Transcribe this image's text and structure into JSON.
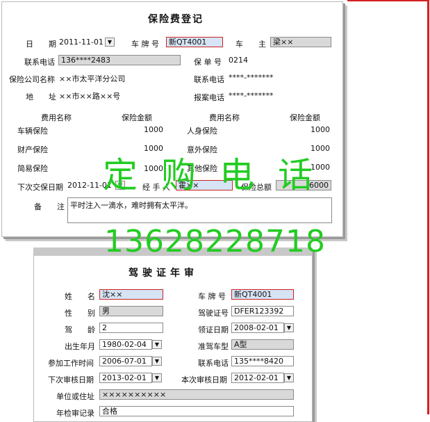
{
  "form1": {
    "title": "保险费登记",
    "date_label": "日　　期",
    "date_value": "2011-11-01",
    "plate_label": "车 牌 号",
    "plate_value": "新QT4001",
    "owner_label": "车　　主",
    "owner_value": "梁××",
    "phone_label": "联系电话",
    "phone_value": "136****2483",
    "policy_label": "保 单 号",
    "policy_value": "0214",
    "company_label": "保险公司名称",
    "company_value": "××市太平洋分公司",
    "company_phone_label": "联系电话",
    "company_phone_value": "****-*******",
    "address_label": "地　　址",
    "address_value": "××市××路××号",
    "report_phone_label": "报案电话",
    "report_phone_value": "****-*******",
    "table": {
      "col_name": "费用名称",
      "col_amount": "保险金额",
      "left_rows": [
        {
          "name": "车辆保险",
          "amount": "1000"
        },
        {
          "name": "财产保险",
          "amount": "1000"
        },
        {
          "name": "简易保险",
          "amount": "1000"
        }
      ],
      "right_rows": [
        {
          "name": "人身保险",
          "amount": "1000"
        },
        {
          "name": "意外保险",
          "amount": "1000"
        },
        {
          "name": "其他保险",
          "amount": "1000"
        }
      ]
    },
    "next_date_label": "下次交保日期",
    "next_date_value": "2012-11-01",
    "handler_label": "经 手 人",
    "handler_value": "霍××",
    "total_label": "保险总额",
    "total_value": "6000",
    "remark_label": "备　　注",
    "remark_value": "平时注入一滴水，难时拥有太平洋。"
  },
  "form2": {
    "title": "驾驶证年审",
    "name_label": "姓　　名",
    "name_value": "沈××",
    "plate_label": "车 牌 号",
    "plate_value": "新QT4001",
    "gender_label": "性　　别",
    "gender_value": "男",
    "license_label": "驾驶证号",
    "license_value": "DFER123392",
    "age_label": "驾　　龄",
    "age_value": "2",
    "issue_label": "领证日期",
    "issue_value": "2008-02-01",
    "birth_label": "出生年月",
    "birth_value": "1980-02-04",
    "class_label": "准驾车型",
    "class_value": "A型",
    "work_label": "参加工作时间",
    "work_value": "2006-07-01",
    "phone_label": "联系电话",
    "phone_value": "135****8420",
    "next_check_label": "下次审核日期",
    "next_check_value": "2013-02-01",
    "this_check_label": "本次审核日期",
    "this_check_value": "2012-02-01",
    "unit_label": "单位或住址",
    "unit_value": "××××××××××",
    "record_label": "年检审记录",
    "record_value": "合格"
  },
  "watermark": {
    "line1": "定购电话",
    "line2": "13628228718"
  }
}
